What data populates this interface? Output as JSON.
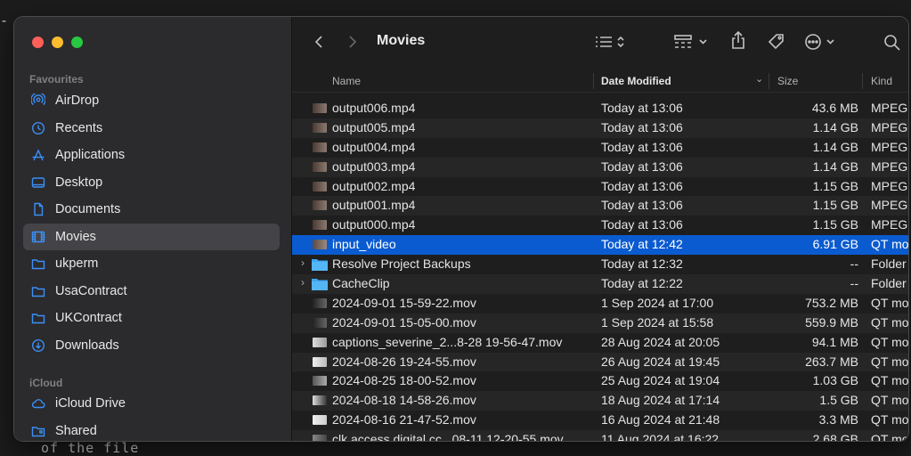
{
  "window": {
    "title": "Movies"
  },
  "sidebar": {
    "sections": [
      {
        "label": "Favourites"
      },
      {
        "label": "iCloud"
      }
    ],
    "items": [
      {
        "label": "AirDrop",
        "icon": "airdrop-icon"
      },
      {
        "label": "Recents",
        "icon": "clock-icon"
      },
      {
        "label": "Applications",
        "icon": "applications-icon"
      },
      {
        "label": "Desktop",
        "icon": "desktop-icon"
      },
      {
        "label": "Documents",
        "icon": "document-icon"
      },
      {
        "label": "Movies",
        "icon": "film-icon",
        "selected": true
      },
      {
        "label": "ukperm",
        "icon": "folder-icon"
      },
      {
        "label": "UsaContract",
        "icon": "folder-icon"
      },
      {
        "label": "UKContract",
        "icon": "folder-icon"
      },
      {
        "label": "Downloads",
        "icon": "download-icon"
      },
      {
        "label": "iCloud Drive",
        "icon": "cloud-icon"
      },
      {
        "label": "Shared",
        "icon": "shared-folder-icon"
      }
    ]
  },
  "columns": {
    "name": "Name",
    "date": "Date Modified",
    "size": "Size",
    "kind": "Kind"
  },
  "files": [
    {
      "name": "output006.mp4",
      "date": "Today at 13:06",
      "size": "43.6 MB",
      "kind": "MPEG"
    },
    {
      "name": "output005.mp4",
      "date": "Today at 13:06",
      "size": "1.14 GB",
      "kind": "MPEG"
    },
    {
      "name": "output004.mp4",
      "date": "Today at 13:06",
      "size": "1.14 GB",
      "kind": "MPEG"
    },
    {
      "name": "output003.mp4",
      "date": "Today at 13:06",
      "size": "1.14 GB",
      "kind": "MPEG"
    },
    {
      "name": "output002.mp4",
      "date": "Today at 13:06",
      "size": "1.15 GB",
      "kind": "MPEG"
    },
    {
      "name": "output001.mp4",
      "date": "Today at 13:06",
      "size": "1.15 GB",
      "kind": "MPEG"
    },
    {
      "name": "output000.mp4",
      "date": "Today at 13:06",
      "size": "1.15 GB",
      "kind": "MPEG"
    },
    {
      "name": "input_video",
      "date": "Today at 12:42",
      "size": "6.91 GB",
      "kind": "QT mo",
      "selected": true
    },
    {
      "name": "Resolve Project Backups",
      "date": "Today at 12:32",
      "size": "--",
      "kind": "Folder",
      "folder": true
    },
    {
      "name": "CacheClip",
      "date": "Today at 12:22",
      "size": "--",
      "kind": "Folder",
      "folder": true
    },
    {
      "name": "2024-09-01 15-59-22.mov",
      "date": "1 Sep 2024 at 17:00",
      "size": "753.2 MB",
      "kind": "QT mo"
    },
    {
      "name": "2024-09-01 15-05-00.mov",
      "date": "1 Sep 2024 at 15:58",
      "size": "559.9 MB",
      "kind": "QT mo"
    },
    {
      "name": "captions_severine_2...8-28 19-56-47.mov",
      "date": "28 Aug 2024 at 20:05",
      "size": "94.1 MB",
      "kind": "QT mo"
    },
    {
      "name": "2024-08-26 19-24-55.mov",
      "date": "26 Aug 2024 at 19:45",
      "size": "263.7 MB",
      "kind": "QT mo"
    },
    {
      "name": "2024-08-25 18-00-52.mov",
      "date": "25 Aug 2024 at 19:04",
      "size": "1.03 GB",
      "kind": "QT mo"
    },
    {
      "name": "2024-08-18 14-58-26.mov",
      "date": "18 Aug 2024 at 17:14",
      "size": "1.5 GB",
      "kind": "QT mo"
    },
    {
      "name": "2024-08-16 21-47-52.mov",
      "date": "16 Aug 2024 at 21:48",
      "size": "3.3 MB",
      "kind": "QT mo"
    },
    {
      "name": "clk access digital cc...08-11 12-20-55.mov",
      "date": "11 Aug 2024 at 16:22",
      "size": "2.68 GB",
      "kind": "QT mo"
    }
  ],
  "background": {
    "terminal_bottom": "of the file"
  }
}
